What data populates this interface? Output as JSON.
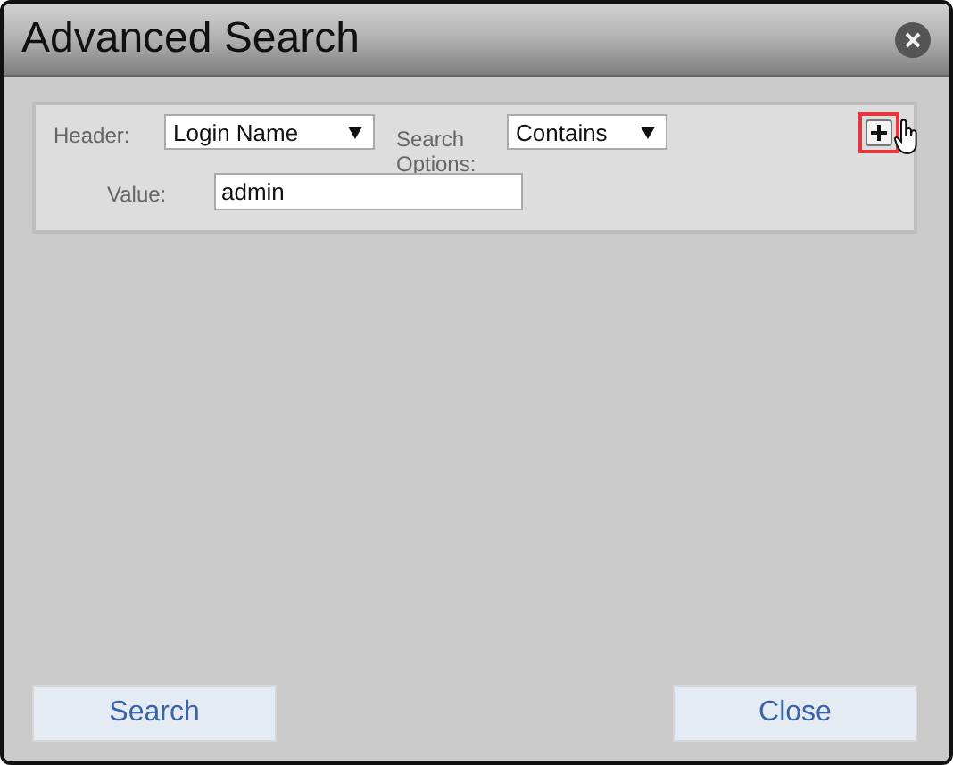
{
  "window": {
    "title": "Advanced Search"
  },
  "criteria": [
    {
      "header_label": "Header:",
      "header_value": "Login Name",
      "options_label": "Search Options:",
      "options_value": "Contains",
      "value_label": "Value:",
      "value": "admin",
      "add_highlighted": true
    }
  ],
  "buttons": [
    "Search",
    "Close"
  ]
}
